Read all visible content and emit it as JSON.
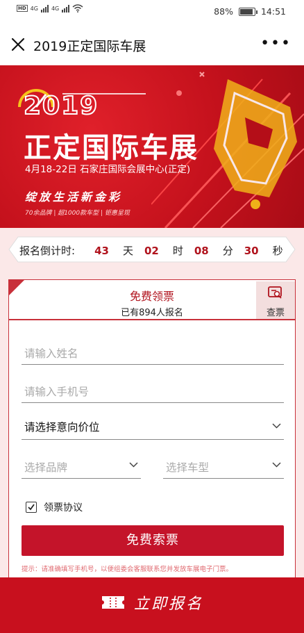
{
  "status_bar": {
    "battery": "88%",
    "battery_level": 0.88,
    "time": "14:51",
    "net_label_1": "4G",
    "net_label_2": "4G"
  },
  "nav": {
    "title": "2019正定国际车展",
    "more": "•••"
  },
  "banner": {
    "year": "2019",
    "title": "正定国际车展",
    "date_venue": "4月18-22日  石家庄国际会展中心(正定)",
    "slogan": "绽放生活新金彩",
    "sub": "70余品牌 | 超1000款车型 | 钜惠呈现"
  },
  "countdown": {
    "label": "报名倒计时:",
    "days": "43",
    "days_unit": "天",
    "hours": "02",
    "hours_unit": "时",
    "minutes": "08",
    "minutes_unit": "分",
    "seconds": "30",
    "seconds_unit": "秒"
  },
  "form": {
    "title": "免费领票",
    "count_text": "已有894人报名",
    "query_label": "查票",
    "name_placeholder": "请输入姓名",
    "phone_placeholder": "请输入手机号",
    "price_select": "请选择意向价位",
    "brand_placeholder": "选择品牌",
    "model_placeholder": "选择车型",
    "agreement_label": "领票协议",
    "agreement_checked": true,
    "submit_label": "免费索票",
    "hint": "提示：请准确填写手机号，以便组委会客服联系您并发放车展电子门票。"
  },
  "bottom_bar": {
    "label": "立即报名"
  },
  "colors": {
    "accent": "#c8101e",
    "accent_text": "#b0121c",
    "bg_pink": "#fbe8e8"
  }
}
